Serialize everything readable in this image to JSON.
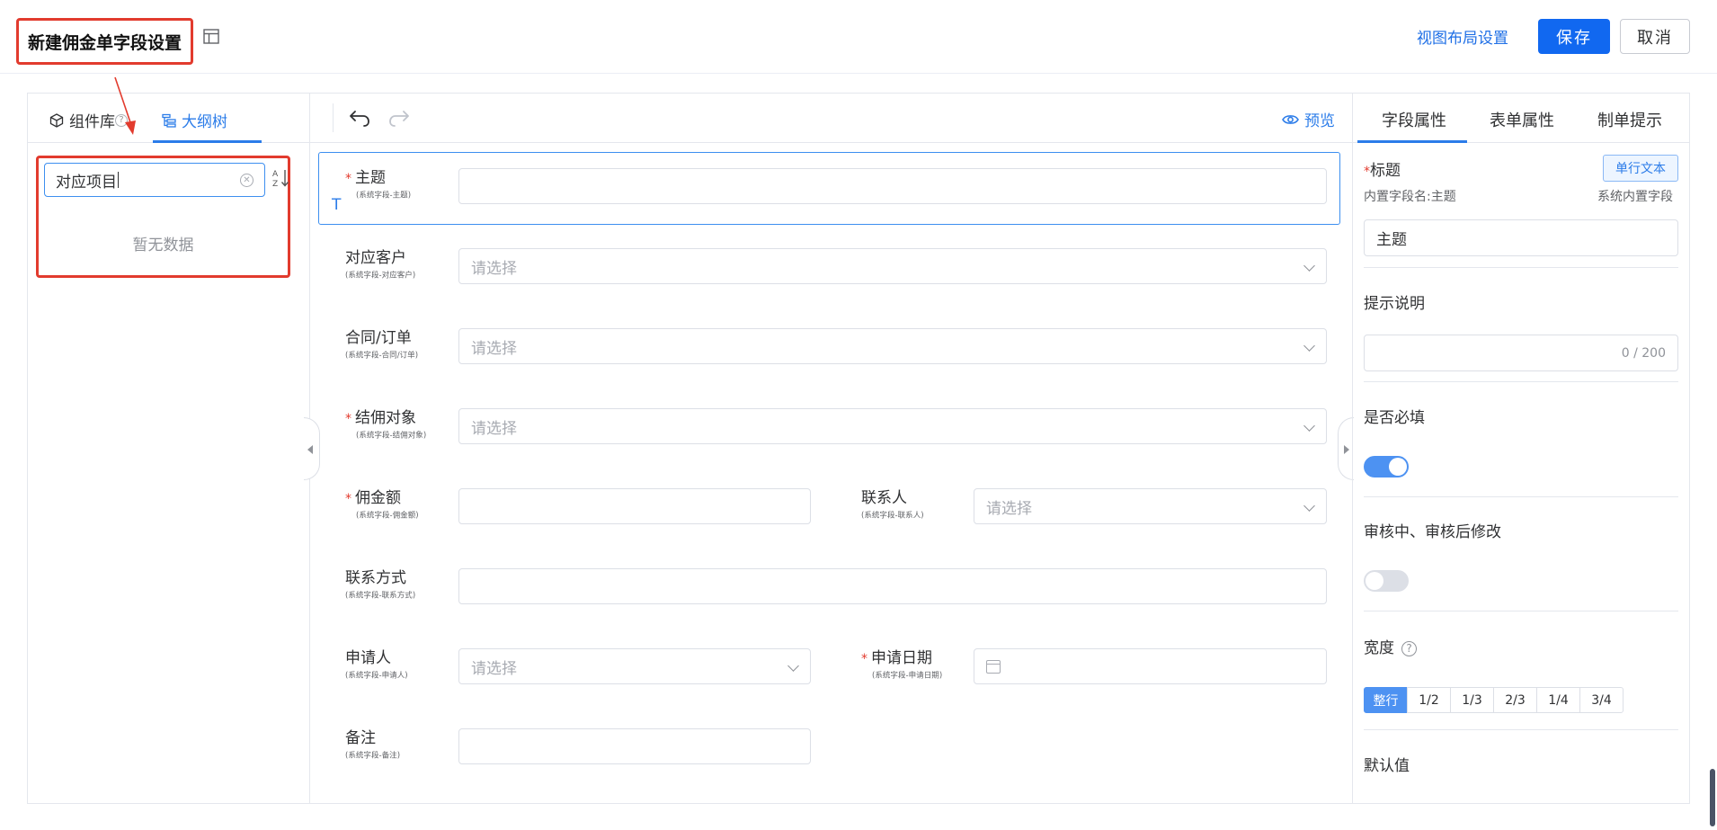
{
  "header": {
    "title": "新建佣金单字段设置",
    "view_layout_label": "视图布局设置",
    "save_label": "保存",
    "cancel_label": "取消"
  },
  "left_panel": {
    "tabs": [
      {
        "label": "组件库",
        "icon": "cube-icon"
      },
      {
        "label": "大纲树",
        "icon": "tree-icon",
        "active": true
      }
    ],
    "search_value": "对应项目",
    "empty_text": "暂无数据"
  },
  "toolbar": {
    "preview_label": "预览"
  },
  "form_fields": [
    {
      "label": "主题",
      "sub": "(系统字段-主题)",
      "required": true,
      "value": "",
      "type": "text"
    },
    {
      "label": "对应客户",
      "sub": "(系统字段-对应客户)",
      "required": false,
      "placeholder": "请选择",
      "type": "select"
    },
    {
      "label": "合同/订单",
      "sub": "(系统字段-合同/订单)",
      "required": false,
      "placeholder": "请选择",
      "type": "select"
    },
    {
      "label": "结佣对象",
      "sub": "(系统字段-结佣对象)",
      "required": true,
      "placeholder": "请选择",
      "type": "select"
    },
    {
      "label": "佣金额",
      "sub": "(系统字段-佣金额)",
      "required": true,
      "value": "",
      "type": "text"
    },
    {
      "label": "联系人",
      "sub": "(系统字段-联系人)",
      "required": false,
      "placeholder": "请选择",
      "type": "select"
    },
    {
      "label": "联系方式",
      "sub": "(系统字段-联系方式)",
      "required": false,
      "value": "",
      "type": "text"
    },
    {
      "label": "申请人",
      "sub": "(系统字段-申请人)",
      "required": false,
      "placeholder": "请选择",
      "type": "select"
    },
    {
      "label": "申请日期",
      "sub": "(系统字段-申请日期)",
      "required": true,
      "value": "",
      "type": "date"
    },
    {
      "label": "备注",
      "sub": "(系统字段-备注)",
      "required": false,
      "value": "",
      "type": "text"
    }
  ],
  "selected_field_marker": "T",
  "right_panel": {
    "tabs": [
      {
        "label": "字段属性",
        "active": true
      },
      {
        "label": "表单属性"
      },
      {
        "label": "制单提示"
      }
    ],
    "title_label": "标题",
    "title_tag": "单行文本",
    "builtin_name": "内置字段名:主题",
    "builtin_type": "系统内置字段",
    "title_value": "主题",
    "hint_label": "提示说明",
    "hint_counter": "0 / 200",
    "required_label": "是否必填",
    "required_on": true,
    "edit_after_review_label": "审核中、审核后修改",
    "edit_after_review_on": false,
    "width_label": "宽度",
    "width_help": "?",
    "width_options": [
      "整行",
      "1/2",
      "1/3",
      "2/3",
      "1/4",
      "3/4"
    ],
    "width_selected": "整行",
    "default_label": "默认值"
  },
  "colors": {
    "accent": "#1168f0",
    "annotation_red": "#e23b2e",
    "required_star": "#e23b2e"
  }
}
